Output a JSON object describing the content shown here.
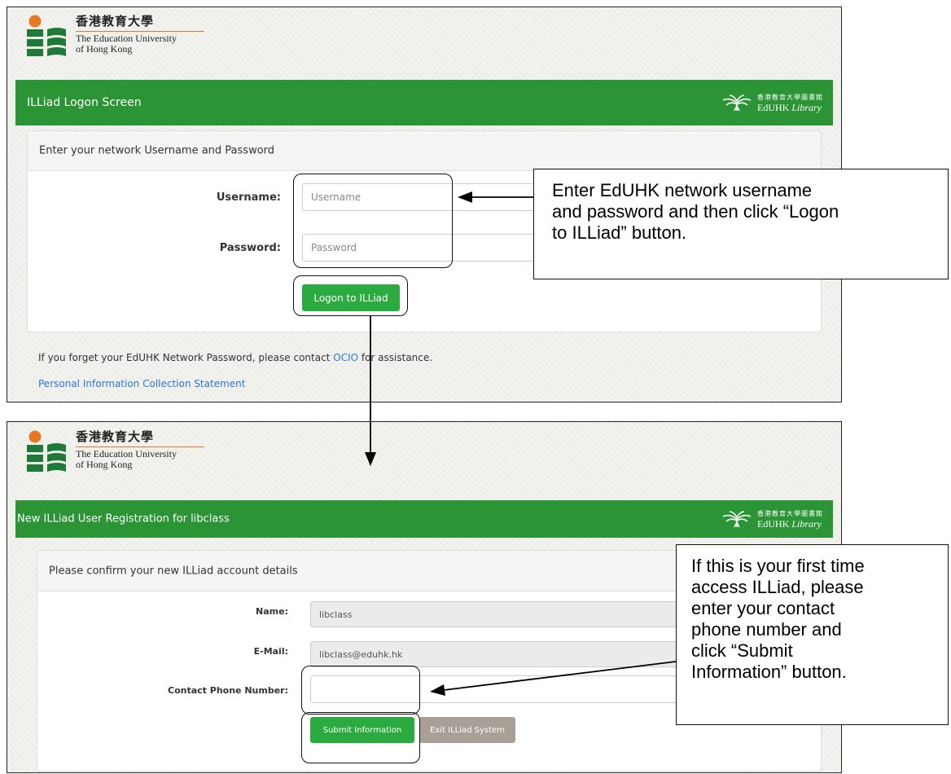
{
  "colors": {
    "banner_green": "#2b9435",
    "button_green": "#2bab3f",
    "button_gray": "#a89f97",
    "link_blue": "#2a7ad1",
    "logo_orange": "#e87722",
    "logo_green": "#1f7a3a"
  },
  "university_logo": {
    "name_cn": "香港教育大學",
    "name_en_line1": "The Education University",
    "name_en_line2": "of Hong Kong",
    "icon": "eduhk-logo-icon"
  },
  "library_logo": {
    "name_cn": "香港教育大學圖書館",
    "name_en": "EdUHK",
    "name_en_italic": "Library",
    "icon": "banyan-tree-icon"
  },
  "logon_screen": {
    "banner_title": "ILLiad Logon Screen",
    "panel_heading": "Enter your network Username and Password",
    "username_label": "Username:",
    "username_placeholder": "Username",
    "password_label": "Password:",
    "password_placeholder": "Password",
    "logon_button": "Logon to ILLiad",
    "help_text_before": "If you forget your EdUHK Network Password, please contact",
    "help_link": "OCIO",
    "help_text_after": "for assistance.",
    "privacy_link": "Personal Information Collection Statement"
  },
  "registration_screen": {
    "banner_title": "New ILLiad User Registration for libclass",
    "panel_heading": "Please confirm your new ILLiad account details",
    "name_label": "Name:",
    "name_value": "libclass",
    "email_label": "E-Mail:",
    "email_value": "libclass@eduhk.hk",
    "phone_label": "Contact Phone Number:",
    "phone_value": "",
    "submit_button": "Submit Information",
    "exit_button": "Exit ILLiad System"
  },
  "callouts": {
    "logon_line1": "Enter EdUHK network username",
    "logon_line2": "and password and then click “Logon",
    "logon_line3": "to ILLiad” button.",
    "reg_line1": "If this is your first time",
    "reg_line2": "access ILLiad, please",
    "reg_line3": "enter your contact",
    "reg_line4": "phone number and",
    "reg_line5": "click “Submit",
    "reg_line6": "Information” button."
  }
}
